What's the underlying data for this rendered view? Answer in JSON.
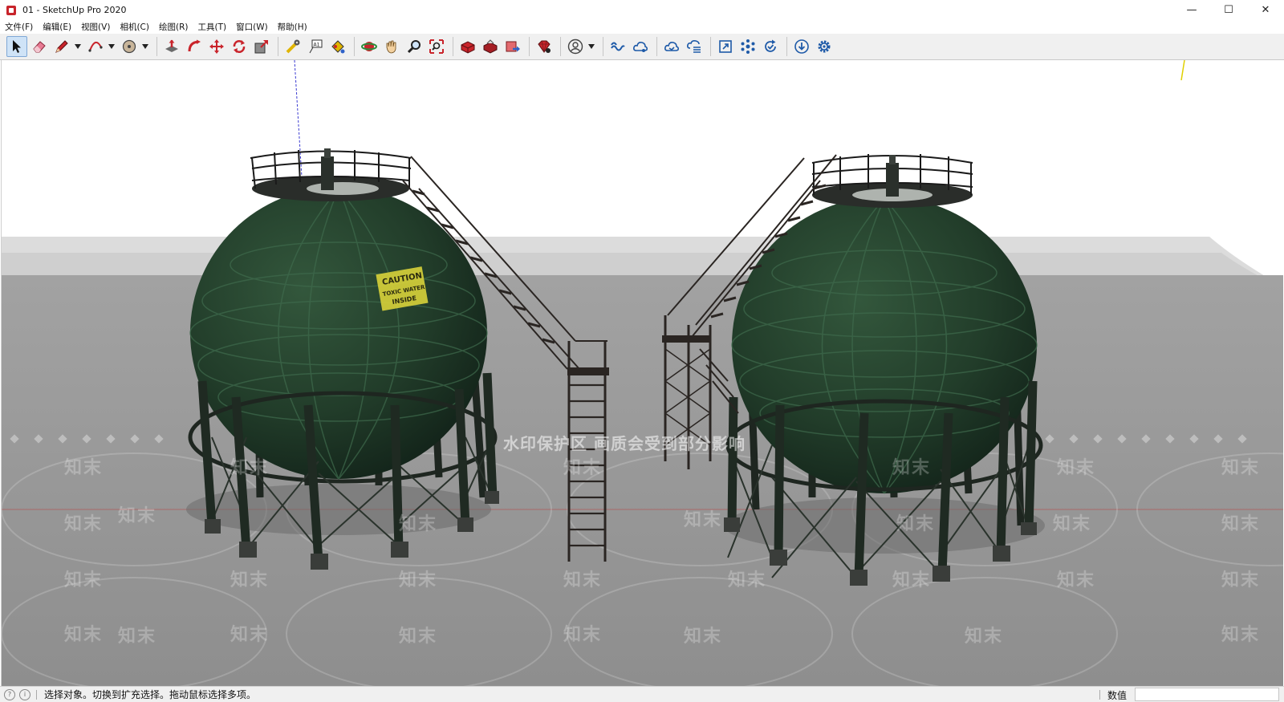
{
  "window": {
    "title": "01 - SketchUp Pro 2020",
    "controls": {
      "minimize": "—",
      "maximize": "☐",
      "close": "✕"
    }
  },
  "menu": {
    "items": [
      "文件(F)",
      "编辑(E)",
      "视图(V)",
      "相机(C)",
      "绘图(R)",
      "工具(T)",
      "窗口(W)",
      "帮助(H)"
    ]
  },
  "toolbar": {
    "groups": [
      [
        "select-tool",
        "eraser-tool",
        "line-tool",
        "arc-tool",
        "shape-tool"
      ],
      [
        "push-pull-tool",
        "follow-me-tool",
        "move-tool",
        "rotate-tool",
        "scale-tool"
      ],
      [
        "tape-measure-tool",
        "text-tool",
        "paint-bucket-tool"
      ],
      [
        "orbit-tool",
        "pan-tool",
        "zoom-tool",
        "zoom-extents-tool"
      ],
      [
        "3d-warehouse",
        "extension-warehouse",
        "send-to-layout"
      ],
      [
        "extension-manager"
      ],
      [
        "account"
      ],
      [
        "trimble-connect-1",
        "trimble-connect-2",
        "trimble-connect-3",
        "trimble-connect-4"
      ],
      [
        "view-tool-1",
        "view-tool-2",
        "view-tool-3"
      ],
      [
        "download-tool",
        "settings-tool"
      ]
    ],
    "active_tool": "select-tool",
    "accent": "#cfe3f7"
  },
  "viewport": {
    "sky_color": "#ffffff",
    "ground_color": "#9a9a9a",
    "tank_color": "#223d2a",
    "sign": {
      "line1": "CAUTION",
      "line2": "TOXIC WATER",
      "line3": "INSIDE"
    },
    "watermark_tile": "知末",
    "watermark_center": "水印保护区 画质会受到部分影响"
  },
  "statusbar": {
    "hint": "选择对象。切换到扩充选择。拖动鼠标选择多项。",
    "measure_label": "数值",
    "measure_value": ""
  }
}
